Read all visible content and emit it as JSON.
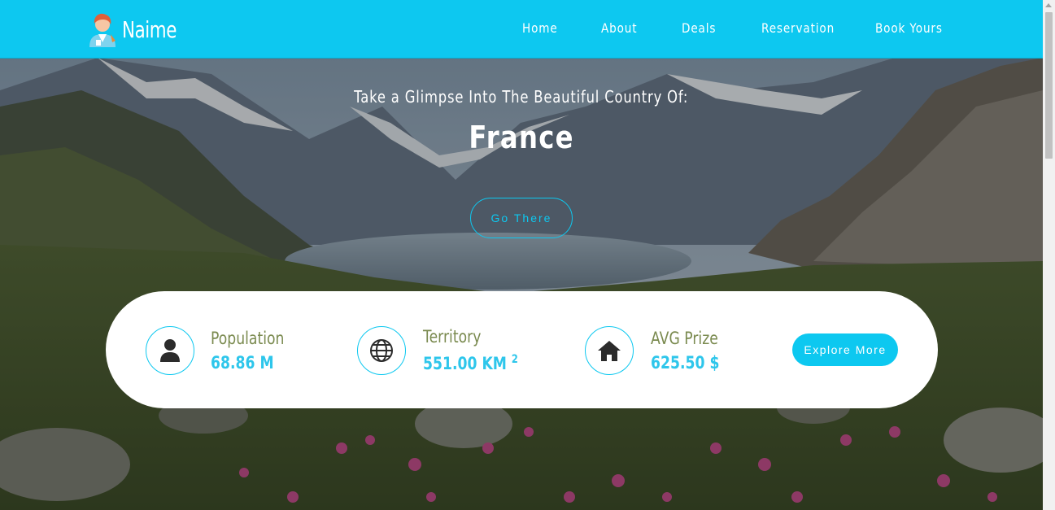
{
  "header": {
    "logo_text": "Naime",
    "nav": [
      {
        "label": "Home"
      },
      {
        "label": "About"
      },
      {
        "label": "Deals"
      },
      {
        "label": "Reservation"
      },
      {
        "label": "Book Yours"
      }
    ]
  },
  "hero": {
    "subtitle": "Take a Glimpse Into The Beautiful Country Of:",
    "title": "France",
    "cta_label": "Go There"
  },
  "stats": {
    "population_label": "Population",
    "population_value": "68.86 M",
    "territory_label": "Territory",
    "territory_value": "551.00 KM",
    "territory_unit_sup": "2",
    "price_label": "AVG Prize",
    "price_value": "625.50 $",
    "explore_label": "Explore More"
  },
  "colors": {
    "accent": "#0dc8f0",
    "stat_label": "#7a8a4f",
    "stat_value": "#2ec6eb"
  },
  "icons": {
    "logo": "person-avatar-icon",
    "population": "user-icon",
    "territory": "globe-icon",
    "price": "home-icon"
  }
}
